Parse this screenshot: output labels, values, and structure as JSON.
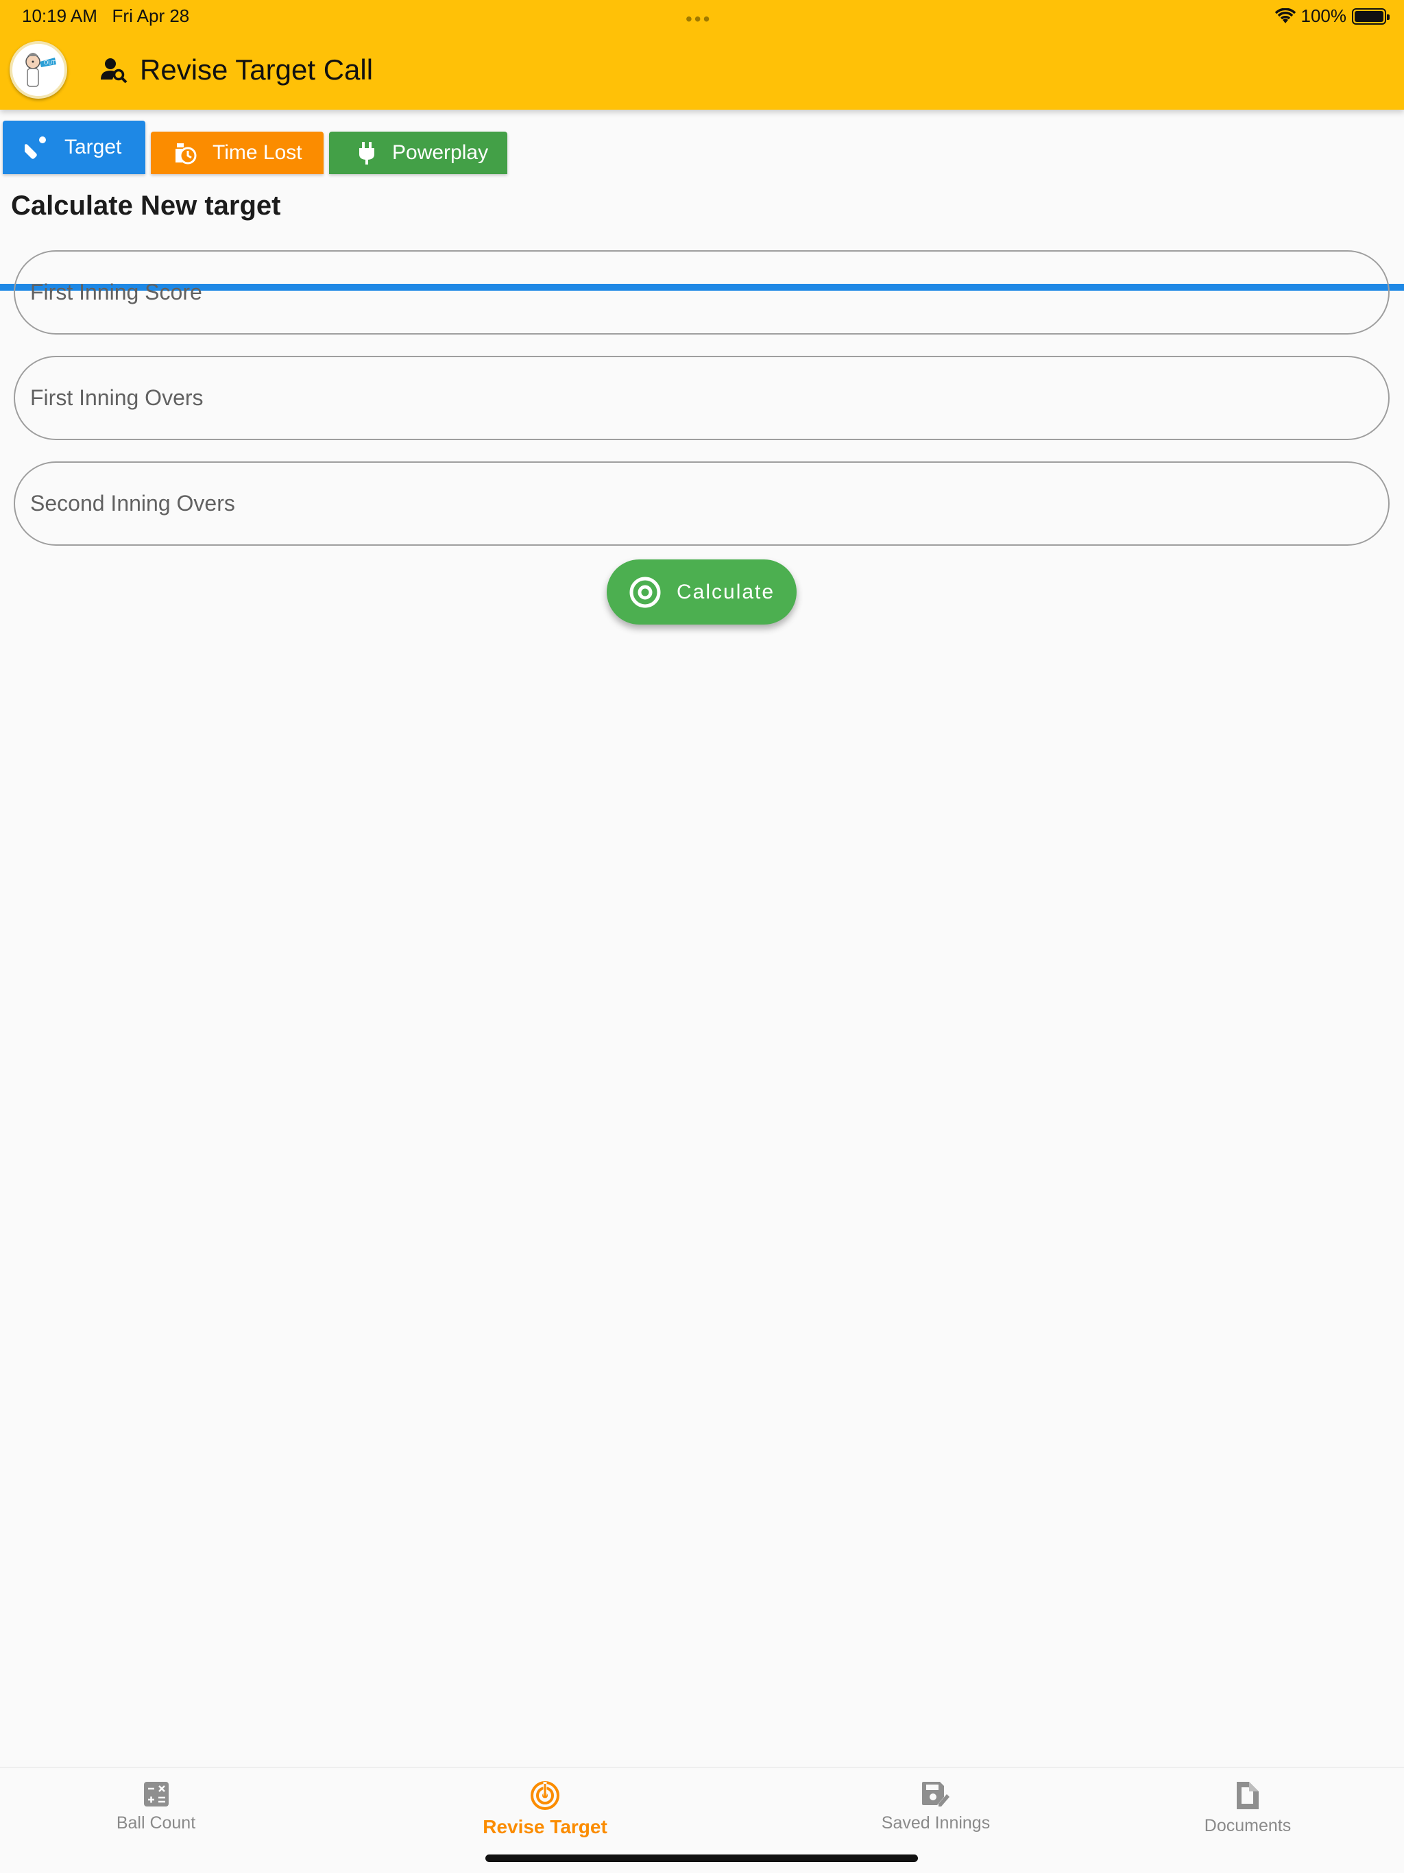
{
  "status_bar": {
    "time": "10:19 AM",
    "date": "Fri Apr 28",
    "battery": "100%"
  },
  "app_bar": {
    "title": "Revise Target Call"
  },
  "tabs": [
    {
      "label": "Target",
      "color": "#1e88e5",
      "selected": true
    },
    {
      "label": "Time Lost",
      "color": "#fb8c00",
      "selected": false
    },
    {
      "label": "Powerplay",
      "color": "#43a047",
      "selected": false
    }
  ],
  "main": {
    "heading": "Calculate New target",
    "fields": [
      {
        "placeholder": "First Inning Score",
        "value": ""
      },
      {
        "placeholder": "First Inning Overs",
        "value": ""
      },
      {
        "placeholder": "Second Inning Overs",
        "value": ""
      }
    ],
    "calculate_label": "Calculate"
  },
  "bottom_nav": [
    {
      "label": "Ball Count",
      "icon": "calculator-icon",
      "active": false
    },
    {
      "label": "Revise Target",
      "icon": "radar-target-icon",
      "active": true
    },
    {
      "label": "Saved Innings",
      "icon": "saved-edit-icon",
      "active": false
    },
    {
      "label": "Documents",
      "icon": "document-icon",
      "active": false
    }
  ],
  "colors": {
    "app_bar": "#ffc107",
    "accent_blue": "#1e88e5",
    "calculate_green": "#4caf50",
    "active_nav": "#fb8c00"
  }
}
